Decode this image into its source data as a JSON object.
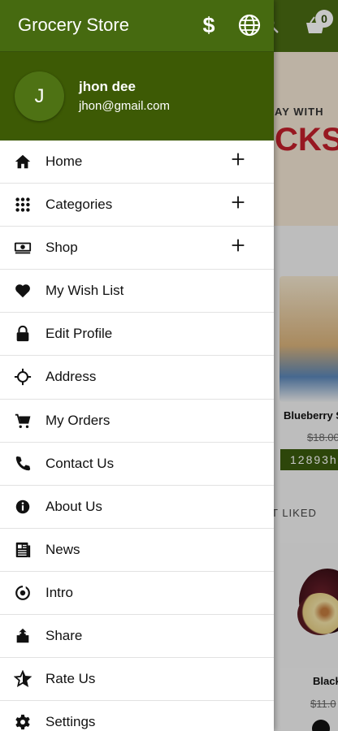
{
  "app": {
    "title": "Grocery Store"
  },
  "header": {
    "currency_symbol": "$",
    "cart_count": "0"
  },
  "user": {
    "initial": "J",
    "name": "jhon dee",
    "email": "jhon@gmail.com"
  },
  "menu": [
    {
      "label": "Home",
      "icon": "home-icon",
      "expandable": true
    },
    {
      "label": "Categories",
      "icon": "grid-icon",
      "expandable": true
    },
    {
      "label": "Shop",
      "icon": "money-icon",
      "expandable": true
    },
    {
      "label": "My Wish List",
      "icon": "heart-icon",
      "expandable": false
    },
    {
      "label": "Edit Profile",
      "icon": "lock-icon",
      "expandable": false
    },
    {
      "label": "Address",
      "icon": "crosshair-icon",
      "expandable": false
    },
    {
      "label": "My Orders",
      "icon": "cart-icon",
      "expandable": false
    },
    {
      "label": "Contact Us",
      "icon": "phone-icon",
      "expandable": false
    },
    {
      "label": "About Us",
      "icon": "info-icon",
      "expandable": false
    },
    {
      "label": "News",
      "icon": "newspaper-icon",
      "expandable": false
    },
    {
      "label": "Intro",
      "icon": "target-icon",
      "expandable": false
    },
    {
      "label": "Share",
      "icon": "share-icon",
      "expandable": false
    },
    {
      "label": "Rate Us",
      "icon": "star-icon",
      "expandable": false
    },
    {
      "label": "Settings",
      "icon": "gear-icon",
      "expandable": false
    }
  ],
  "background": {
    "banner_line1": "AY WITH",
    "banner_line2": "CKS",
    "product1_name": "Blueberry S",
    "product1_price": "$18.00",
    "product1_timer": "12893h:",
    "section_title": "T LIKED",
    "product2_name": "Black",
    "product2_price": "$11.0"
  },
  "colors": {
    "drawer_topbar": "#466a10",
    "profile_bg": "#3d5a05",
    "accent": "#4a6b12",
    "sale_red": "#c21f2b"
  }
}
